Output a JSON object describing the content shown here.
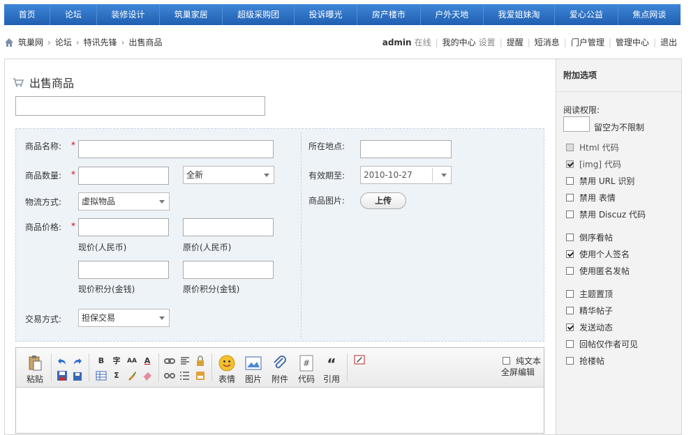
{
  "nav": [
    "首页",
    "论坛",
    "装修设计",
    "筑巢家居",
    "超级采购团",
    "投诉曝光",
    "房产楼市",
    "户外天地",
    "我爱姐妹淘",
    "爱心公益",
    "焦点网谈"
  ],
  "breadcrumb": [
    "筑巢网",
    "论坛",
    "特讯先锋",
    "出售商品"
  ],
  "user": {
    "name": "admin",
    "status": "在线",
    "links": [
      "我的中心",
      "设置"
    ],
    "actions": [
      "提醒",
      "短消息",
      "门户管理",
      "管理中心",
      "退出"
    ]
  },
  "page_title": "出售商品",
  "form": {
    "name_label": "商品名称:",
    "qty_label": "商品数量:",
    "condition_value": "全新",
    "shipping_label": "物流方式:",
    "shipping_value": "虚拟物品",
    "price_label": "商品价格:",
    "price_now_caption": "现价(人民币)",
    "price_orig_caption": "原价(人民币)",
    "credit_now_caption": "现价积分(金钱)",
    "credit_orig_caption": "原价积分(金钱)",
    "trade_label": "交易方式:",
    "trade_value": "担保交易",
    "location_label": "所在地点:",
    "expire_label": "有效期至:",
    "expire_value": "2010-10-27",
    "image_label": "商品图片:",
    "upload_label": "上传",
    "required_mark": "*"
  },
  "toolbar": {
    "paste": "粘贴",
    "emoji": "表情",
    "image": "图片",
    "attach": "附件",
    "code": "代码",
    "quote": "引用",
    "plain_text": "纯文本",
    "fullscreen": "全屏编辑",
    "mini_bold": "B",
    "mini_font": "字",
    "mini_size": "AA",
    "mini_color": "A",
    "mini_sum": "Σ",
    "mini_quote_mark": "“"
  },
  "side": {
    "title": "附加选项",
    "read_perm_label": "阅读权限:",
    "read_perm_hint": "留空为不限制",
    "options": [
      {
        "label": "Html 代码",
        "checked": false,
        "disabled": true
      },
      {
        "label": "[img] 代码",
        "checked": true,
        "disabled": true
      },
      {
        "label": "禁用 URL 识别",
        "checked": false,
        "disabled": false
      },
      {
        "label": "禁用 表情",
        "checked": false,
        "disabled": false
      },
      {
        "label": "禁用 Discuz 代码",
        "checked": false,
        "disabled": false
      },
      {
        "label": "倒序看帖",
        "checked": false,
        "disabled": false
      },
      {
        "label": "使用个人签名",
        "checked": true,
        "disabled": false
      },
      {
        "label": "使用匿名发帖",
        "checked": false,
        "disabled": false
      },
      {
        "label": "主题置顶",
        "checked": false,
        "disabled": false
      },
      {
        "label": "精华帖子",
        "checked": false,
        "disabled": false
      },
      {
        "label": "发送动态",
        "checked": true,
        "disabled": false
      },
      {
        "label": "回帖仅作者可见",
        "checked": false,
        "disabled": false
      },
      {
        "label": "抢楼帖",
        "checked": false,
        "disabled": false
      }
    ]
  }
}
